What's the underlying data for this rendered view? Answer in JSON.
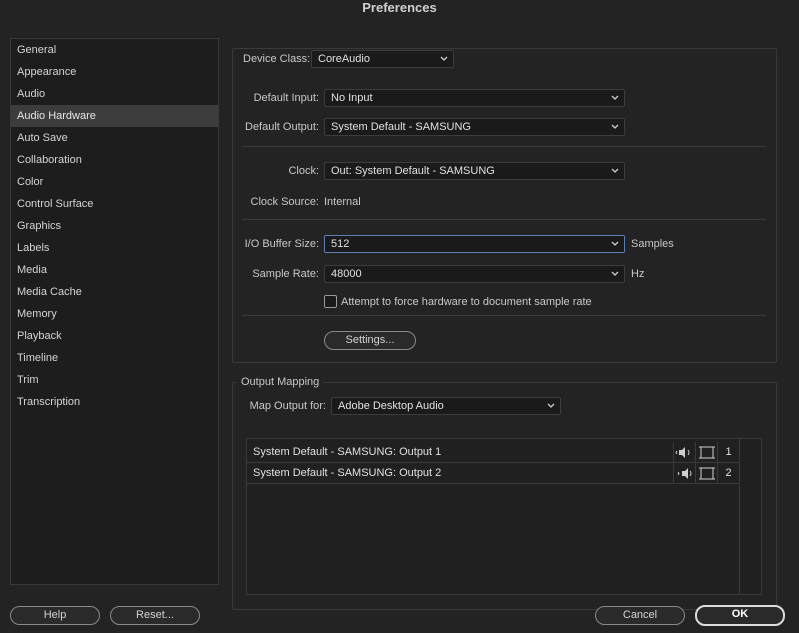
{
  "window": {
    "title": "Preferences"
  },
  "sidebar": {
    "items": [
      {
        "label": "General"
      },
      {
        "label": "Appearance"
      },
      {
        "label": "Audio"
      },
      {
        "label": "Audio Hardware",
        "selected": true
      },
      {
        "label": "Auto Save"
      },
      {
        "label": "Collaboration"
      },
      {
        "label": "Color"
      },
      {
        "label": "Control Surface"
      },
      {
        "label": "Graphics"
      },
      {
        "label": "Labels"
      },
      {
        "label": "Media"
      },
      {
        "label": "Media Cache"
      },
      {
        "label": "Memory"
      },
      {
        "label": "Playback"
      },
      {
        "label": "Timeline"
      },
      {
        "label": "Trim"
      },
      {
        "label": "Transcription"
      }
    ]
  },
  "device": {
    "class_label": "Device Class:",
    "class_value": "CoreAudio",
    "default_input_label": "Default Input:",
    "default_input_value": "No Input",
    "default_output_label": "Default Output:",
    "default_output_value": "System Default - SAMSUNG",
    "clock_label": "Clock:",
    "clock_value": "Out: System Default - SAMSUNG",
    "clock_source_label": "Clock Source:",
    "clock_source_value": "Internal",
    "buffer_label": "I/O Buffer Size:",
    "buffer_value": "512",
    "buffer_unit": "Samples",
    "rate_label": "Sample Rate:",
    "rate_value": "48000",
    "rate_unit": "Hz",
    "force_rate_label": "Attempt to force hardware to document sample rate",
    "force_rate_checked": false,
    "settings_button": "Settings..."
  },
  "output_mapping": {
    "legend": "Output Mapping",
    "map_label": "Map Output for:",
    "map_value": "Adobe Desktop Audio",
    "rows": [
      {
        "name": "System Default - SAMSUNG: Output 1",
        "channel": "1"
      },
      {
        "name": "System Default - SAMSUNG: Output 2",
        "channel": "2"
      }
    ]
  },
  "footer": {
    "help": "Help",
    "reset": "Reset...",
    "cancel": "Cancel",
    "ok": "OK"
  },
  "icons": {
    "chevron": "chevron-down-icon",
    "speaker_left": "speaker-left-icon",
    "speaker_right": "speaker-right-icon",
    "frame": "frame-icon"
  },
  "colors": {
    "background": "#232323",
    "selected_item": "#3d3d3d",
    "focus_border": "#5a7fb0"
  }
}
